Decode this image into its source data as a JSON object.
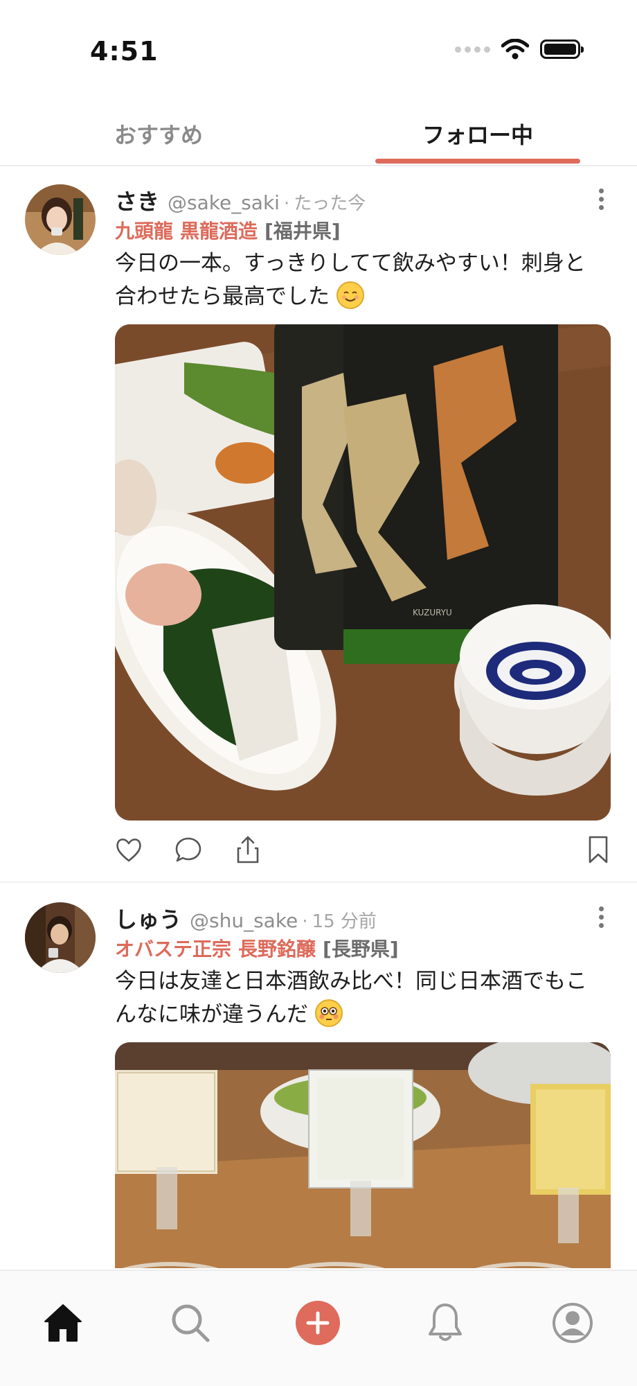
{
  "status_bar": {
    "time": "4:51"
  },
  "tabs": [
    {
      "label": "おすすめ",
      "active": false
    },
    {
      "label": "フォロー中",
      "active": true
    }
  ],
  "posts": [
    {
      "name": "さき",
      "handle": "@sake_saki",
      "separator": "·",
      "time": "たった今",
      "sake": "九頭龍",
      "brewery": "黒龍酒造",
      "prefecture": "[福井県]",
      "text_line1": "今日の一本。すっきりしてて飲みやすい！刺身と",
      "text_line2": "合わせたら最高でした"
    },
    {
      "name": "しゅう",
      "handle": "@shu_sake",
      "separator": "·",
      "time": "15 分前",
      "sake": "オバステ正宗",
      "brewery": "長野銘醸",
      "prefecture": "[長野県]",
      "text_line1": "今日は友達と日本酒飲み比べ！同じ日本酒でもこ",
      "text_line2": "んなに味が違うんだ"
    }
  ],
  "colors": {
    "accent": "#de6b5c",
    "text": "#1f1f1f",
    "muted": "#8d8d8d"
  },
  "bottom_nav": [
    "home-icon",
    "search-icon",
    "add-post-icon",
    "bell-icon",
    "profile-icon"
  ]
}
